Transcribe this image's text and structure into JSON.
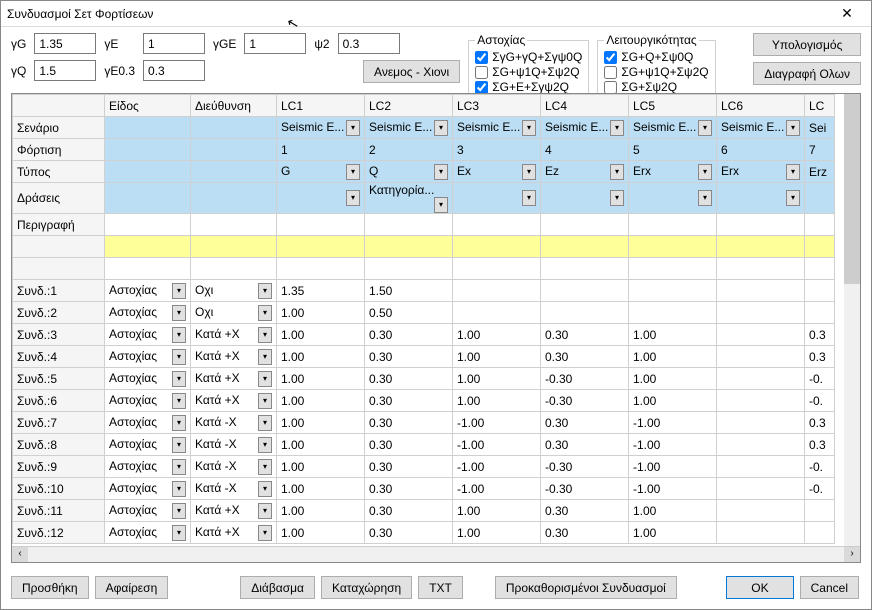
{
  "title": "Συνδυασμοί Σετ Φορτίσεων",
  "params": {
    "gG_label": "γG",
    "gG": "1.35",
    "gE_label": "γE",
    "gE": "1",
    "gGE_label": "γGE",
    "gGE": "1",
    "psi2_label": "ψ2",
    "psi2": "0.3",
    "gQ_label": "γQ",
    "gQ": "1.5",
    "gE03_label": "γE0.3",
    "gE03": "0.3"
  },
  "anemos_btn": "Ανεμος - Χιονι",
  "astoxias": {
    "legend": "Αστοχίας",
    "c1": {
      "label": "ΣγG+γQ+Σγψ0Q",
      "checked": true
    },
    "c2": {
      "label": "ΣG+ψ1Q+Σψ2Q",
      "checked": false
    },
    "c3": {
      "label": "ΣG+E+Σγψ2Q",
      "checked": true
    }
  },
  "leit": {
    "legend": "Λειτουργικότητας",
    "c1": {
      "label": "ΣG+Q+Σψ0Q",
      "checked": true
    },
    "c2": {
      "label": "ΣG+ψ1Q+Σψ2Q",
      "checked": false
    },
    "c3": {
      "label": "ΣG+Σψ2Q",
      "checked": false
    }
  },
  "calc_btn": "Υπολογισμός",
  "del_all_btn": "Διαγραφή Ολων",
  "headers": {
    "eidos": "Είδος",
    "dieuth": "Διεύθυνση",
    "lc1": "LC1",
    "lc2": "LC2",
    "lc3": "LC3",
    "lc4": "LC4",
    "lc5": "LC5",
    "lc6": "LC6",
    "lc7": "LC"
  },
  "header_rows": {
    "senario": "Σενάριο",
    "fortisi": "Φόρτιση",
    "typos": "Τύπος",
    "draseis": "Δράσεις",
    "perigrafi": "Περιγραφή"
  },
  "senario_vals": {
    "lc1": "Seismic E...",
    "lc2": "Seismic E...",
    "lc3": "Seismic E...",
    "lc4": "Seismic E...",
    "lc5": "Seismic E...",
    "lc6": "Seismic E...",
    "lc7": "Sei"
  },
  "fortisi_vals": {
    "lc1": "1",
    "lc2": "2",
    "lc3": "3",
    "lc4": "4",
    "lc5": "5",
    "lc6": "6",
    "lc7": "7"
  },
  "typos_vals": {
    "lc1": "G",
    "lc2": "Q",
    "lc3": "Ex",
    "lc4": "Ez",
    "lc5": "Erx",
    "lc6": "Erx",
    "lc7": "Erz"
  },
  "draseis_vals": {
    "lc2": "Κατηγορία..."
  },
  "combos": [
    {
      "n": "Συνδ.:1",
      "e": "Αστοχίας",
      "d": "Οχι",
      "v": [
        "1.35",
        "1.50",
        "",
        "",
        "",
        "",
        ""
      ]
    },
    {
      "n": "Συνδ.:2",
      "e": "Αστοχίας",
      "d": "Οχι",
      "v": [
        "1.00",
        "0.50",
        "",
        "",
        "",
        "",
        ""
      ]
    },
    {
      "n": "Συνδ.:3",
      "e": "Αστοχίας",
      "d": "Κατά +X",
      "v": [
        "1.00",
        "0.30",
        "1.00",
        "0.30",
        "1.00",
        "",
        "0.3"
      ]
    },
    {
      "n": "Συνδ.:4",
      "e": "Αστοχίας",
      "d": "Κατά +X",
      "v": [
        "1.00",
        "0.30",
        "1.00",
        "0.30",
        "1.00",
        "",
        "0.3"
      ]
    },
    {
      "n": "Συνδ.:5",
      "e": "Αστοχίας",
      "d": "Κατά +X",
      "v": [
        "1.00",
        "0.30",
        "1.00",
        "-0.30",
        "1.00",
        "",
        "-0."
      ]
    },
    {
      "n": "Συνδ.:6",
      "e": "Αστοχίας",
      "d": "Κατά +X",
      "v": [
        "1.00",
        "0.30",
        "1.00",
        "-0.30",
        "1.00",
        "",
        "-0."
      ]
    },
    {
      "n": "Συνδ.:7",
      "e": "Αστοχίας",
      "d": "Κατά -X",
      "v": [
        "1.00",
        "0.30",
        "-1.00",
        "0.30",
        "-1.00",
        "",
        "0.3"
      ]
    },
    {
      "n": "Συνδ.:8",
      "e": "Αστοχίας",
      "d": "Κατά -X",
      "v": [
        "1.00",
        "0.30",
        "-1.00",
        "0.30",
        "-1.00",
        "",
        "0.3"
      ]
    },
    {
      "n": "Συνδ.:9",
      "e": "Αστοχίας",
      "d": "Κατά -X",
      "v": [
        "1.00",
        "0.30",
        "-1.00",
        "-0.30",
        "-1.00",
        "",
        "-0."
      ]
    },
    {
      "n": "Συνδ.:10",
      "e": "Αστοχίας",
      "d": "Κατά -X",
      "v": [
        "1.00",
        "0.30",
        "-1.00",
        "-0.30",
        "-1.00",
        "",
        "-0."
      ]
    },
    {
      "n": "Συνδ.:11",
      "e": "Αστοχίας",
      "d": "Κατά +X",
      "v": [
        "1.00",
        "0.30",
        "1.00",
        "0.30",
        "1.00",
        "",
        ""
      ]
    },
    {
      "n": "Συνδ.:12",
      "e": "Αστοχίας",
      "d": "Κατά +X",
      "v": [
        "1.00",
        "0.30",
        "1.00",
        "0.30",
        "1.00",
        "",
        ""
      ]
    }
  ],
  "footer": {
    "add": "Προσθήκη",
    "remove": "Αφαίρεση",
    "read": "Διάβασμα",
    "save": "Καταχώρηση",
    "txt": "TXT",
    "preset": "Προκαθορισμένοι Συνδυασμοί",
    "ok": "OK",
    "cancel": "Cancel"
  }
}
